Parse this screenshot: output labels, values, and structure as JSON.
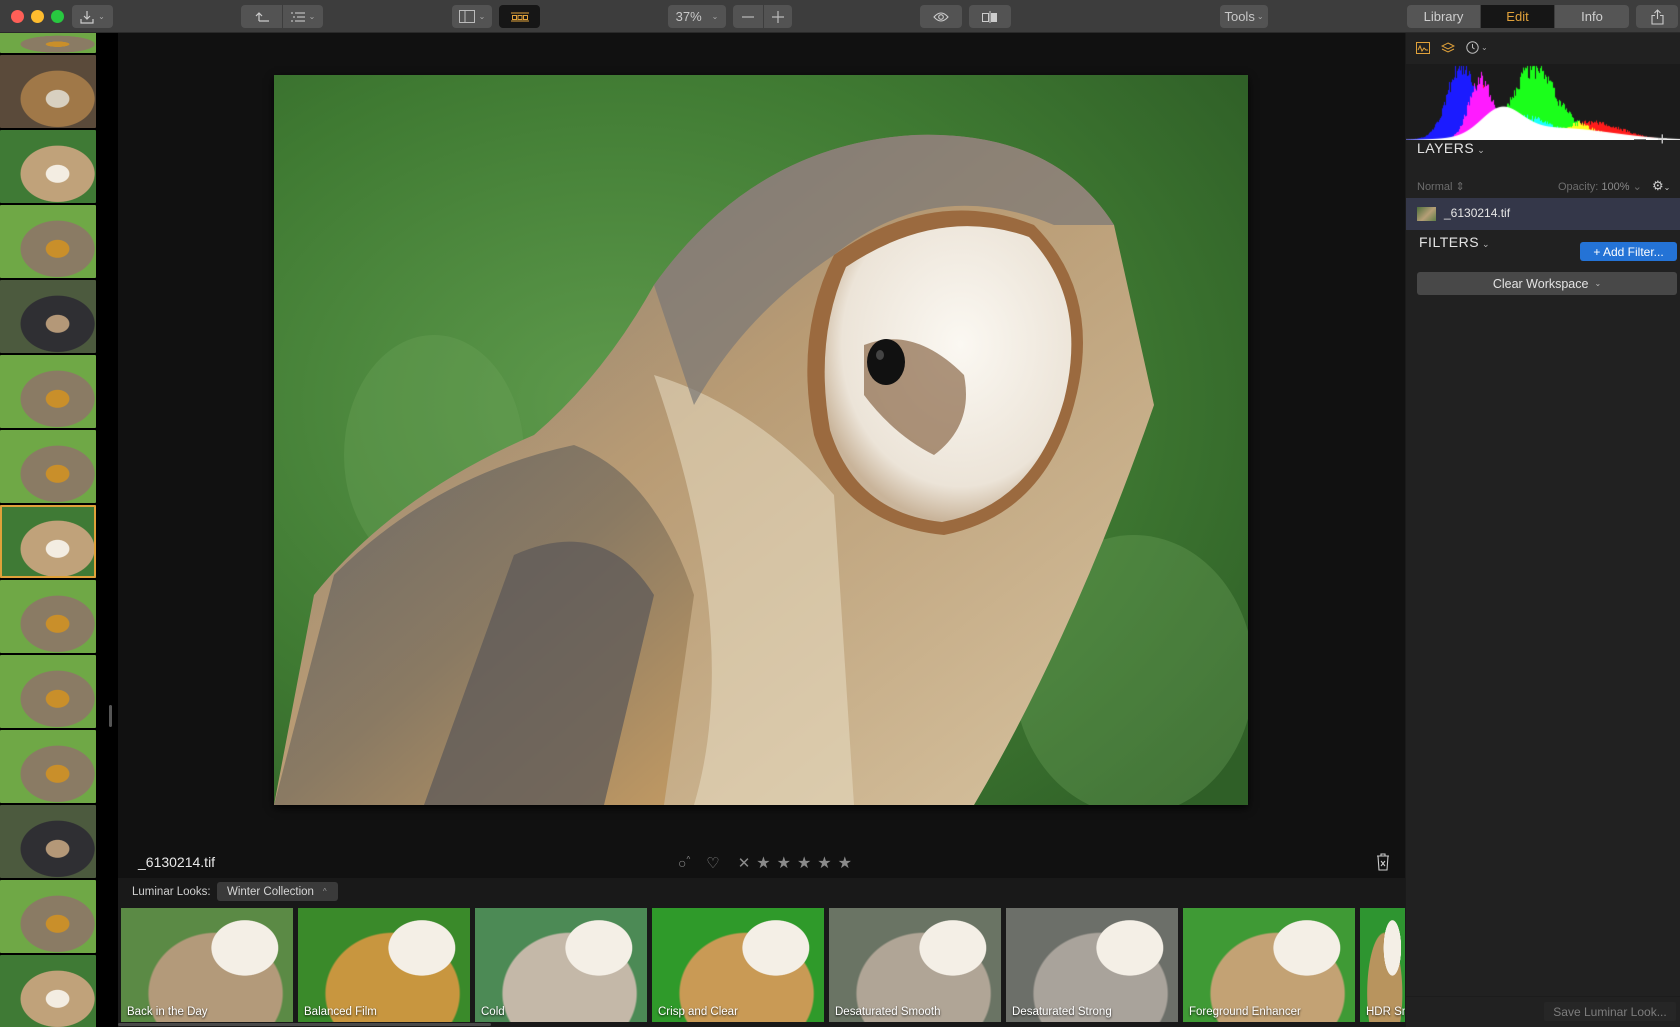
{
  "toolbar": {
    "zoom_level": "37%",
    "tools_label": "Tools",
    "mode_tabs": [
      {
        "label": "Library",
        "active": false
      },
      {
        "label": "Edit",
        "active": true
      },
      {
        "label": "Info",
        "active": false
      }
    ],
    "icons": {
      "import": "download-icon",
      "undo": "undo-arrow-icon",
      "list": "list-icon",
      "sidebar": "sidebar-toggle-icon",
      "filmstrip": "filmstrip-icon",
      "zoom_out": "minus-icon",
      "zoom_in": "plus-icon",
      "preview": "eye-icon",
      "compare": "compare-split-icon",
      "share": "share-icon"
    },
    "accent_color": "#e0a13a"
  },
  "filmstrip": {
    "items": [
      {
        "subject": "great-horned-owl",
        "selected": false
      },
      {
        "subject": "hawk",
        "selected": false
      },
      {
        "subject": "barn-owl",
        "selected": false
      },
      {
        "subject": "great-horned-owl",
        "selected": false
      },
      {
        "subject": "falcon",
        "selected": false
      },
      {
        "subject": "great-horned-owl",
        "selected": false
      },
      {
        "subject": "great-horned-owl",
        "selected": false
      },
      {
        "subject": "barn-owl",
        "selected": true
      },
      {
        "subject": "great-horned-owl",
        "selected": false
      },
      {
        "subject": "great-horned-owl",
        "selected": false
      },
      {
        "subject": "great-horned-owl",
        "selected": false
      },
      {
        "subject": "falcon",
        "selected": false
      },
      {
        "subject": "great-horned-owl",
        "selected": false
      },
      {
        "subject": "barn-owl",
        "selected": false
      }
    ]
  },
  "canvas": {
    "photo_subject": "barn-owl",
    "filename": "_6130214.tif",
    "rating": {
      "stars": 0,
      "max_stars": 5,
      "flag": "none",
      "favorite": false
    }
  },
  "looks": {
    "label": "Luminar Looks:",
    "collection": "Winter Collection",
    "items": [
      {
        "label": "Back in the Day",
        "tint": "vintage"
      },
      {
        "label": "Balanced Film",
        "tint": "film"
      },
      {
        "label": "Cold",
        "tint": "cold"
      },
      {
        "label": "Crisp and Clear",
        "tint": "crisp"
      },
      {
        "label": "Desaturated Smooth",
        "tint": "desat"
      },
      {
        "label": "Desaturated Strong",
        "tint": "desat-strong"
      },
      {
        "label": "Foreground Enhancer",
        "tint": "fg"
      },
      {
        "label": "HDR Sn",
        "tint": "hdr"
      }
    ]
  },
  "panel": {
    "layers_title": "LAYERS",
    "blend_mode": "Normal",
    "opacity_label": "Opacity:",
    "opacity_value": "100%",
    "layer_name": "_6130214.tif",
    "filters_title": "FILTERS",
    "add_filter_label": "+ Add Filter...",
    "workspace_label": "Clear Workspace",
    "save_look_label": "Save Luminar Look...",
    "add_filter_color": "#2473d6"
  }
}
